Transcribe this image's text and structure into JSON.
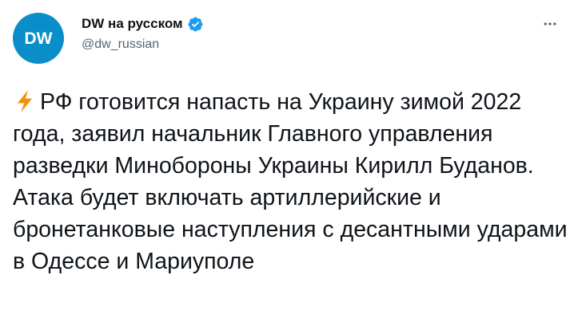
{
  "author": {
    "display_name": "DW на русском",
    "handle": "@dw_russian",
    "avatar_text": "DW",
    "verified": true
  },
  "tweet": {
    "emoji": "lightning-icon",
    "text": "РФ готовится напасть на Украину зимой 2022 года, заявил начальник Главного управления разведки Минобороны Украины Кирилл Буданов. Атака будет включать артиллерийские и бронетанковые наступления с десантными ударами в Одессе и Мариуполе"
  },
  "colors": {
    "avatar_bg": "#0a8ec9",
    "verified": "#1d9bf0",
    "handle_text": "#536471",
    "body_text": "#0f1419",
    "lightning": "#f4900c"
  },
  "icons": {
    "more": "more-horizontal-icon",
    "verified": "verified-badge-icon"
  }
}
